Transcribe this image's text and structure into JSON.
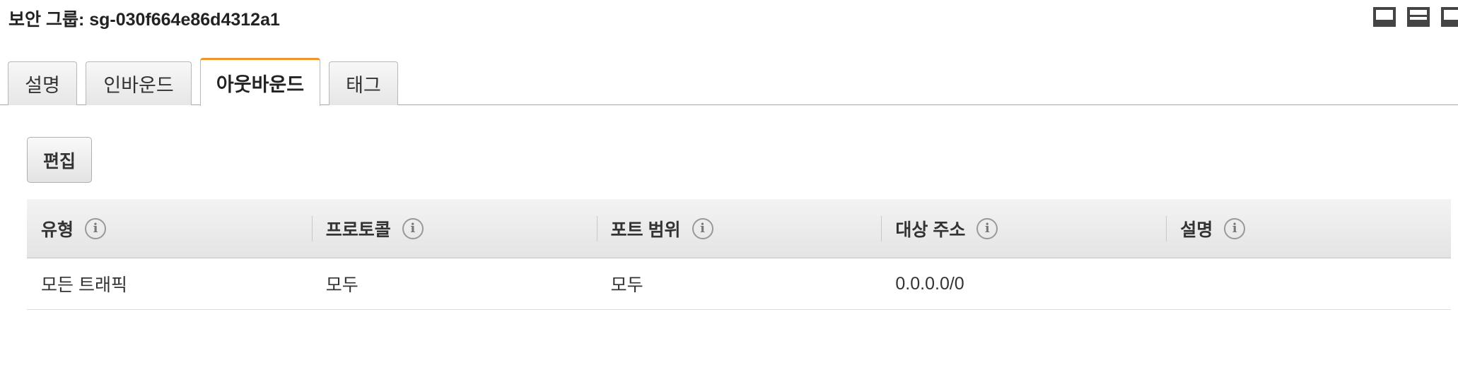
{
  "header": {
    "title": "보안 그룹: sg-030f664e86d4312a1",
    "layout_icons": [
      "panel-bottom-icon",
      "panel-split-icon",
      "panel-side-icon"
    ]
  },
  "tabs": [
    {
      "label": "설명",
      "active": false
    },
    {
      "label": "인바운드",
      "active": false
    },
    {
      "label": "아웃바운드",
      "active": true
    },
    {
      "label": "태그",
      "active": false
    }
  ],
  "toolbar": {
    "edit_label": "편집"
  },
  "table": {
    "columns": [
      "유형",
      "프로토콜",
      "포트 범위",
      "대상 주소",
      "설명"
    ],
    "info_glyph": "i",
    "rows": [
      [
        "모든 트래픽",
        "모두",
        "모두",
        "0.0.0.0/0",
        ""
      ]
    ]
  },
  "colors": {
    "active_tab_accent": "#f0952e",
    "header_bg": "#e8e8e8",
    "text": "#222222"
  }
}
